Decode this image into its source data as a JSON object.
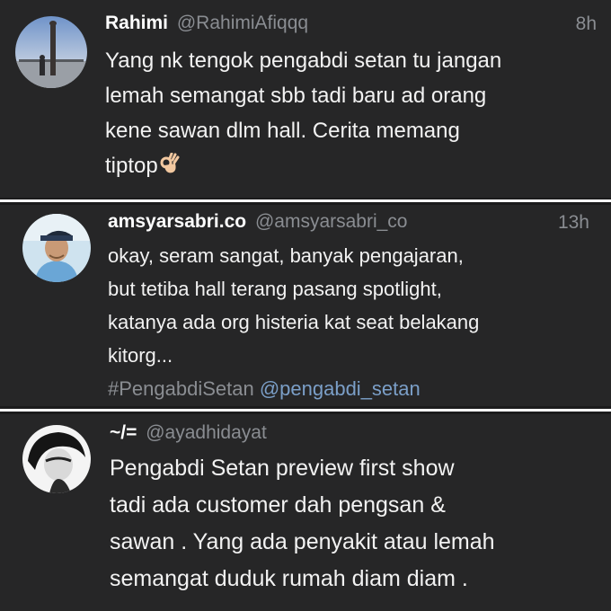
{
  "tweets": [
    {
      "name": "Rahimi",
      "handle": "@RahimiAfiqqq",
      "time": "8h",
      "lines": [
        "Yang nk tengok pengabdi setan tu jangan",
        "lemah semangat sbb tadi baru ad orang",
        "kene sawan dlm hall. Cerita memang",
        "tiptop"
      ],
      "emoji": "ok-hand-emoji"
    },
    {
      "name": "amsyarsabri.co",
      "handle": "@amsyarsabri_co",
      "time": "13h",
      "lines": [
        "okay, seram sangat, banyak pengajaran,",
        "but tetiba hall terang pasang spotlight,",
        "katanya ada org histeria kat seat belakang",
        "kitorg..."
      ],
      "hashtag": "#PengabdiSetan",
      "mention": "@pengabdi_setan"
    },
    {
      "name": "~/=",
      "handle": "@ayadhidayat",
      "lines": [
        "Pengabdi Setan preview first show",
        "tadi ada customer dah pengsan &",
        "sawan . Yang ada penyakit atau lemah",
        "semangat duduk rumah diam diam ."
      ]
    }
  ]
}
